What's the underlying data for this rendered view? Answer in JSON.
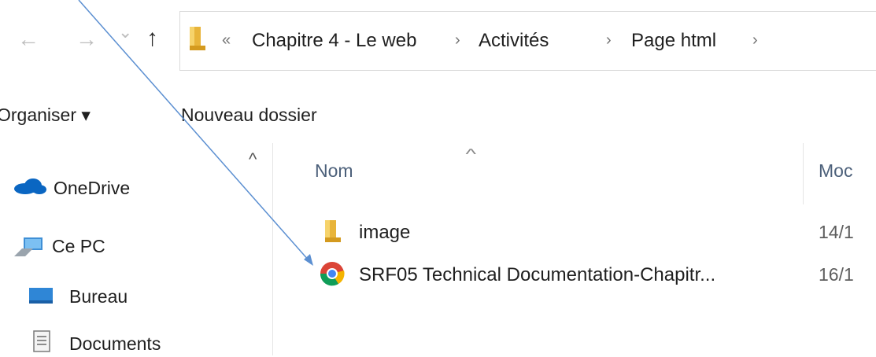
{
  "nav": {
    "back_glyph": "←",
    "forward_glyph": "→",
    "recent_glyph": "⌄",
    "up_glyph": "↑"
  },
  "address": {
    "overflow_glyph": "«",
    "separator": "›",
    "crumbs": [
      "Chapitre 4 - Le web",
      "Activités",
      "Page html"
    ]
  },
  "toolbar": {
    "organise_label": "Organiser ▾",
    "new_folder_label": "Nouveau dossier"
  },
  "sidebar": {
    "items": [
      {
        "label": "OneDrive",
        "icon": "onedrive-cloud-icon"
      },
      {
        "label": "Ce PC",
        "icon": "this-pc-icon"
      },
      {
        "label": "Bureau",
        "icon": "desktop-icon"
      },
      {
        "label": "Documents",
        "icon": "documents-icon"
      }
    ]
  },
  "list": {
    "sort_indicator": "^",
    "columns": {
      "name": "Nom",
      "modified": "Moc"
    },
    "rows": [
      {
        "name": "image",
        "date": "14/1",
        "icon": "folder-icon"
      },
      {
        "name": "SRF05 Technical Documentation-Chapitr...",
        "date": "16/1",
        "icon": "chrome-html-file-icon"
      }
    ]
  },
  "colors": {
    "folder": "#e8b43a",
    "onedrive": "#0a66c2",
    "annotation_line": "#5b8fd1",
    "header_text": "#4c607a"
  }
}
